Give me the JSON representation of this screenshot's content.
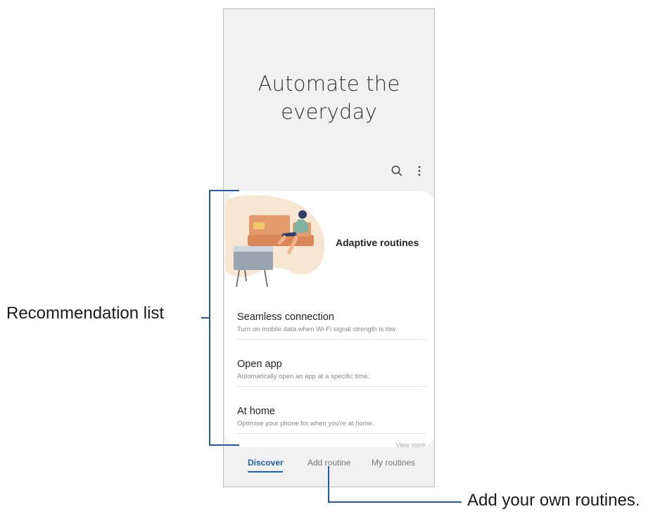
{
  "hero": {
    "line1": "Automate the",
    "line2": "everyday"
  },
  "toolbar": {
    "search_icon": "search-icon",
    "more_icon": "more-options-icon"
  },
  "card": {
    "featured_title": "Adaptive routines",
    "items": [
      {
        "title": "Seamless connection",
        "description": "Turn on mobile data when Wi-Fi signal strength is low."
      },
      {
        "title": "Open app",
        "description": "Automatically open an app at a specific time."
      },
      {
        "title": "At home",
        "description": "Optimise your phone for when you're at home."
      }
    ],
    "view_more": "View more"
  },
  "nav": {
    "tabs": [
      {
        "label": "Discover",
        "active": true
      },
      {
        "label": "Add routine",
        "active": false
      },
      {
        "label": "My routines",
        "active": false
      }
    ]
  },
  "callouts": {
    "left": "Recommendation list",
    "bottom": "Add your own routines."
  },
  "colors": {
    "accent": "#1b5fb0",
    "callout_line": "#1f5ba6",
    "screen_background": "#f1f1f1",
    "illustration_blob": "#f6e6d2",
    "sofa": "#e39a6c"
  }
}
